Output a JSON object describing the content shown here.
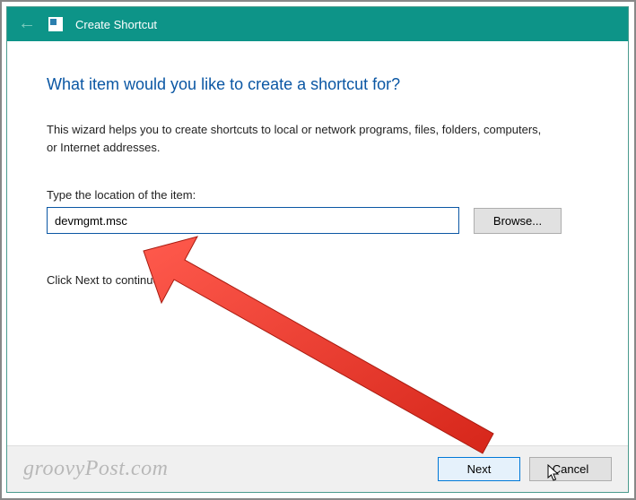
{
  "titlebar": {
    "title": "Create Shortcut"
  },
  "content": {
    "heading": "What item would you like to create a shortcut for?",
    "description": "This wizard helps you to create shortcuts to local or network programs, files, folders, computers, or Internet addresses.",
    "field_label": "Type the location of the item:",
    "location_value": "devmgmt.msc",
    "browse_label": "Browse...",
    "continue_text": "Click Next to continue."
  },
  "footer": {
    "watermark": "groovyPost.com",
    "next_label": "Next",
    "cancel_label": "Cancel"
  }
}
